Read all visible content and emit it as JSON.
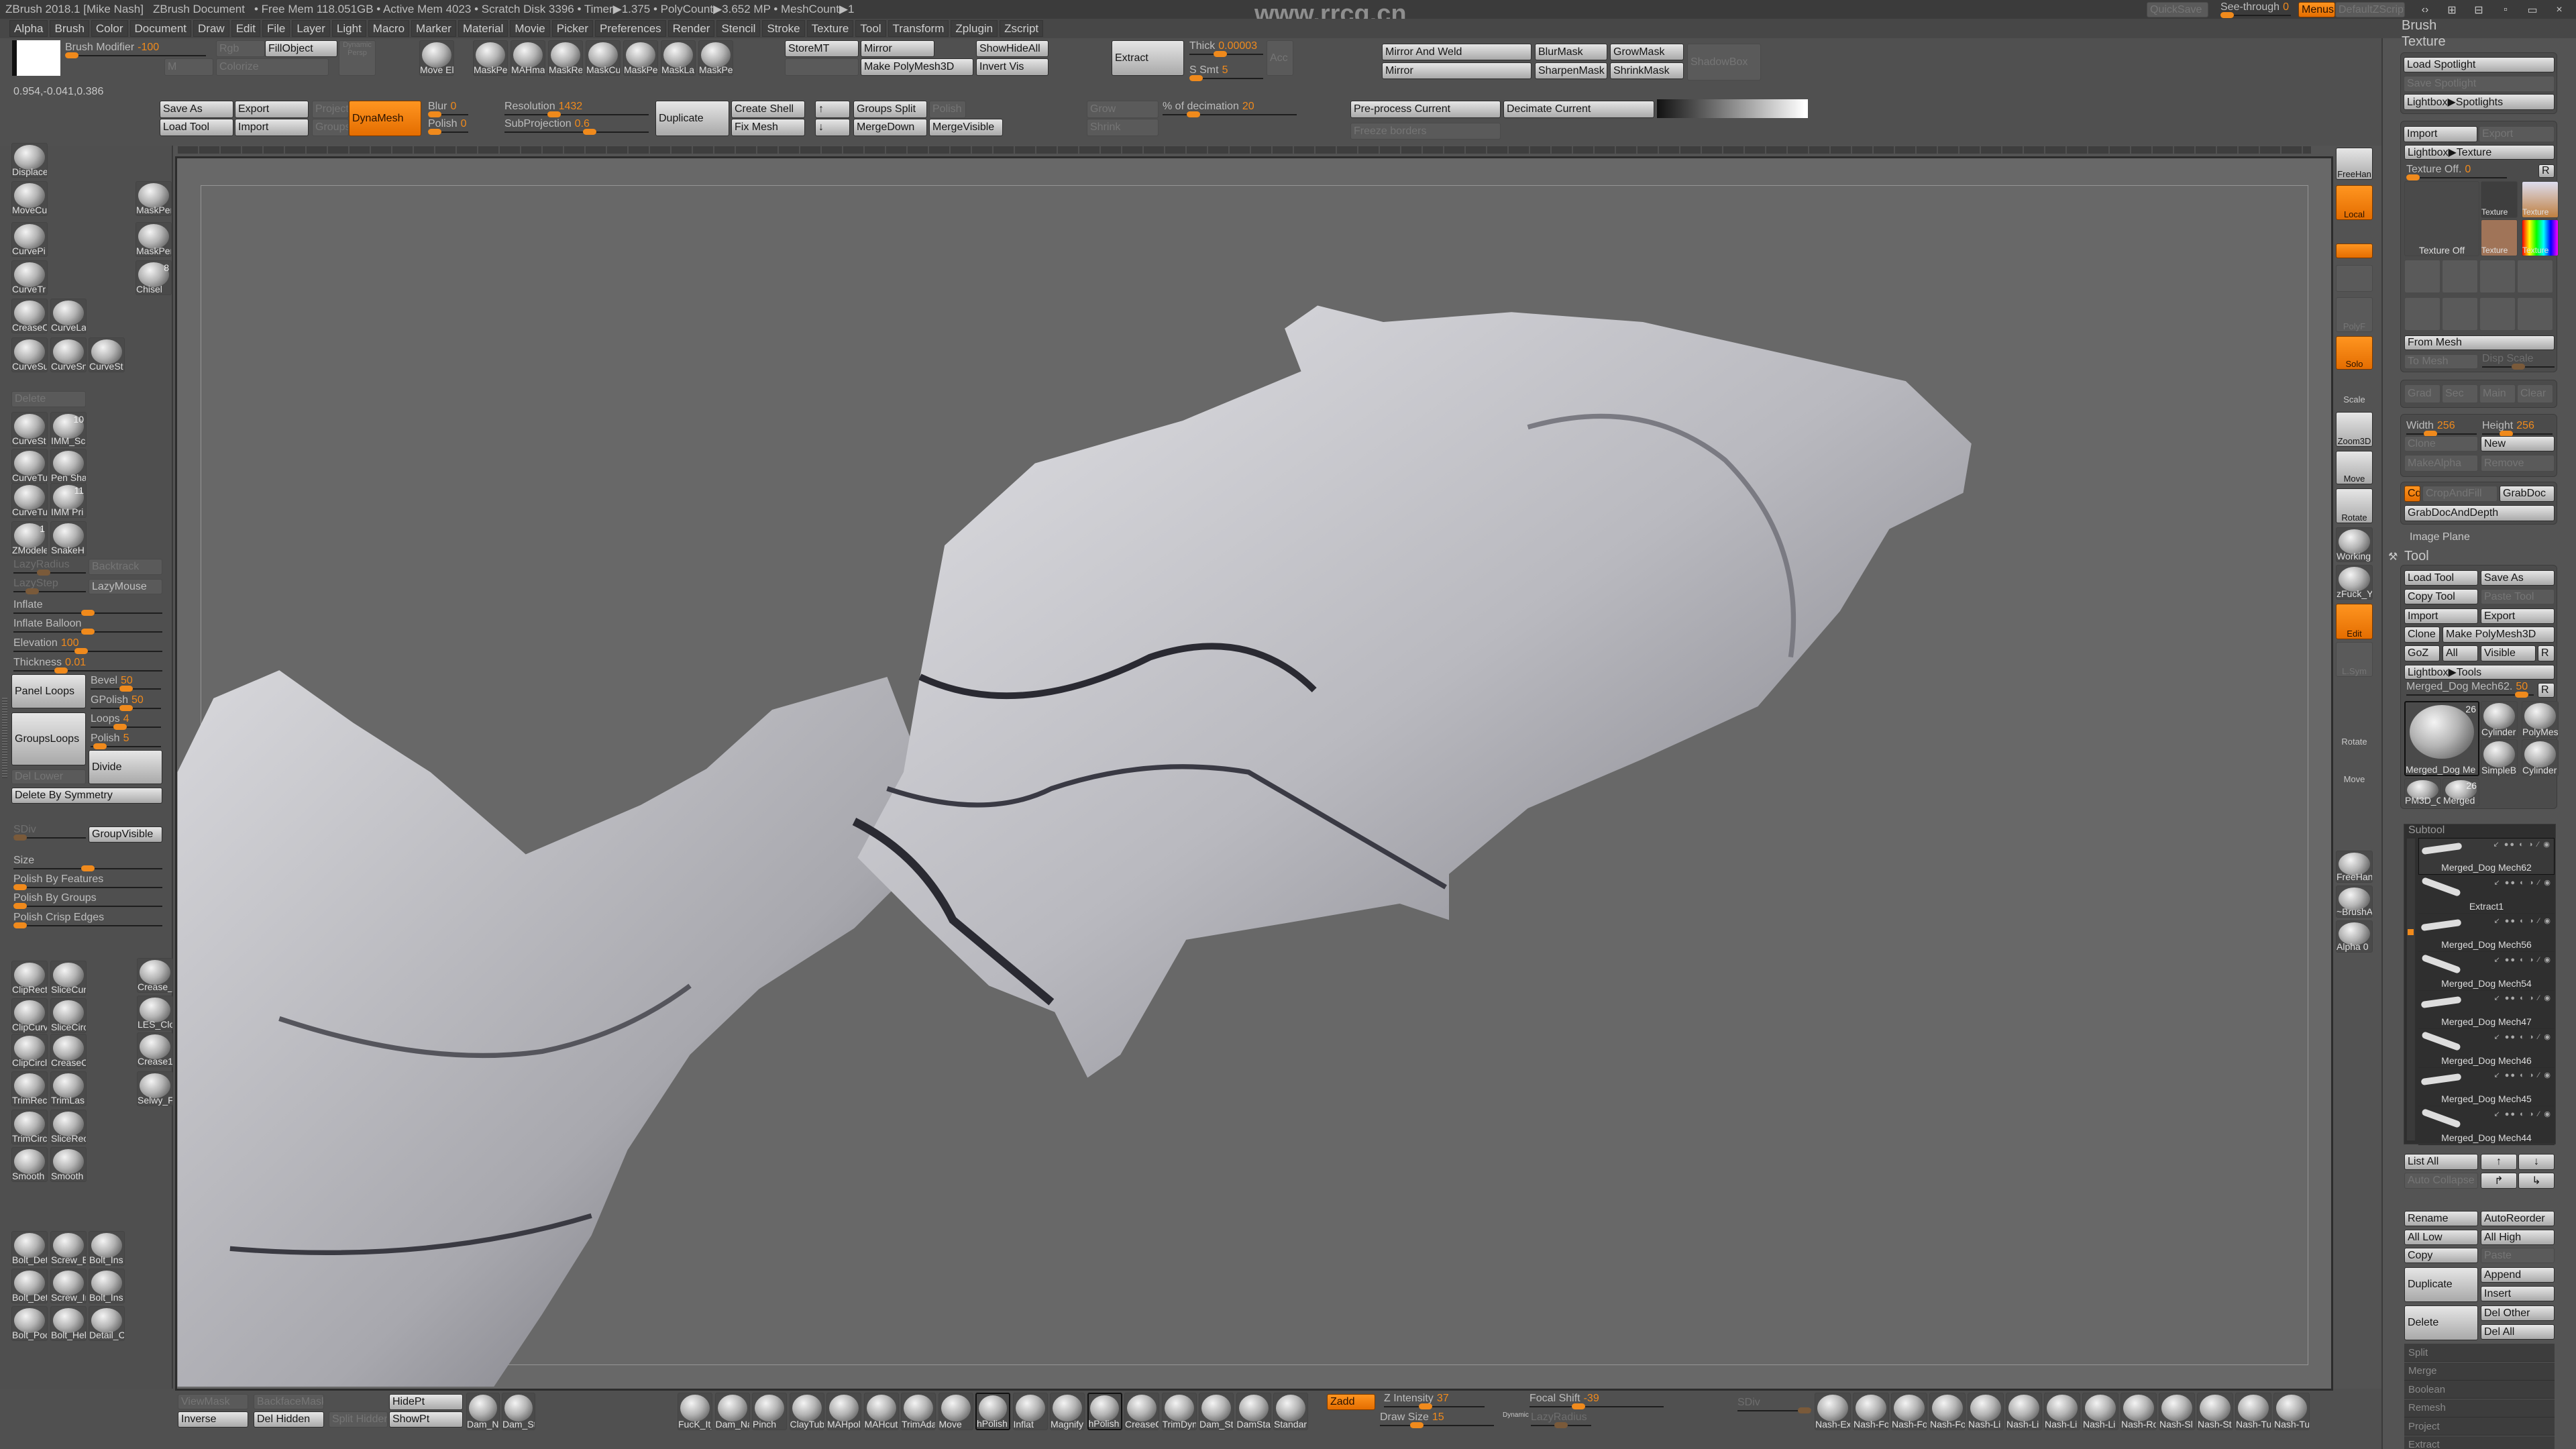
{
  "title_bar": {
    "app": "ZBrush 2018.1 [Mike Nash]",
    "document": "ZBrush Document",
    "stats": "• Free Mem 118.051GB • Active Mem 4023 • Scratch Disk 3396 • Timer▶1.375 • PolyCount▶3.652 MP • MeshCount▶1",
    "watermark": "www.rrcg.cn",
    "quicksave": "QuickSave",
    "see_through_label": "See-through",
    "see_through_value": "0",
    "menus": "Menus",
    "default_zscript": "DefaultZScript"
  },
  "menu": [
    "Alpha",
    "Brush",
    "Color",
    "Document",
    "Draw",
    "Edit",
    "File",
    "Layer",
    "Light",
    "Macro",
    "Marker",
    "Material",
    "Movie",
    "Picker",
    "Preferences",
    "Render",
    "Stencil",
    "Stroke",
    "Texture",
    "Tool",
    "Transform",
    "Zplugin",
    "Zscript"
  ],
  "top_shelf": {
    "brush_modifier_label": "Brush Modifier",
    "brush_modifier_value": "-100",
    "rgb": "Rgb",
    "fill_object": "FillObject",
    "m": "M",
    "colorize": "Colorize",
    "dynamic": "Dynamic",
    "persp": "Persp",
    "coords": "0.954,-0.041,0.386",
    "mask_brushes": [
      "Move El",
      "MaskPe",
      "MAHma",
      "MaskRe",
      "MaskCu",
      "MaskPe",
      "MaskLa",
      "MaskPe"
    ],
    "store_mt": "StoreMT",
    "mirror": "Mirror",
    "show_hide_all": "ShowHideAll",
    "make_polymesh": "Make PolyMesh3D",
    "invert_vis": "Invert Vis",
    "extract": "Extract",
    "thick_label": "Thick",
    "thick_value": "0.00003",
    "ssmt_label": "S Smt",
    "ssmt_value": "5",
    "acc": "Acc",
    "save_as": "Save As",
    "export": "Export",
    "project": "Project",
    "dynamesh": "DynaMesh",
    "load_tool": "Load Tool",
    "import": "Import",
    "groups": "Groups",
    "blur_label": "Blur",
    "blur_value": "0",
    "polish_label": "Polish",
    "polish_value": "0",
    "resolution_label": "Resolution",
    "resolution_value": "1432",
    "subprojection_label": "SubProjection",
    "subprojection_value": "0.6",
    "duplicate": "Duplicate",
    "create_shell": "Create Shell",
    "fix_mesh": "Fix Mesh",
    "up": "↑",
    "down": "↓",
    "groups_split": "Groups Split",
    "merge_down": "MergeDown",
    "polish": "Polish",
    "merge_visible": "MergeVisible",
    "grow": "Grow",
    "shrink": "Shrink",
    "decimation_label": "% of decimation",
    "decimation_value": "20",
    "mirror_and_weld": "Mirror And Weld",
    "blur_mask": "BlurMask",
    "grow_mask": "GrowMask",
    "shadowbox": "ShadowBox",
    "mirror2": "Mirror",
    "sharpen_mask": "SharpenMask",
    "shrink_mask": "ShrinkMask",
    "preprocess_current": "Pre-process Current",
    "decimate_current": "Decimate Current",
    "freeze_borders": "Freeze borders"
  },
  "left_panel": {
    "brushes_top": [
      {
        "label": "Displace"
      },
      {
        "label": "MoveCu"
      },
      {
        "label": "MaskPen"
      },
      {
        "label": "CurvePi"
      },
      {
        "label": "MaskPen"
      },
      {
        "label": "CurveTr"
      },
      {
        "label": "Chisel",
        "badge": "8"
      },
      {
        "label": "CreaseC"
      },
      {
        "label": "CurveLa"
      },
      {
        "label": "CurveSu"
      },
      {
        "label": "CurveSn"
      },
      {
        "label": "CurveSt"
      },
      {
        "label": "CurveSt"
      },
      {
        "label": "IMM_Sci",
        "badge": "10"
      },
      {
        "label": "CurveTu"
      },
      {
        "label": "Pen Sha"
      },
      {
        "label": "CurveTu"
      },
      {
        "label": "IMM Pri",
        "badge": "11"
      },
      {
        "label": "ZModele",
        "badge": "1"
      },
      {
        "label": "SnakeH"
      }
    ],
    "delete": "Delete",
    "lazy_radius": "LazyRadius",
    "backtrack": "Backtrack",
    "lazy_step": "LazyStep",
    "lazy_mouse": "LazyMouse",
    "inflate": "Inflate",
    "inflate_balloon": "Inflate Balloon",
    "elevation_label": "Elevation",
    "elevation_value": "100",
    "thickness_label": "Thickness",
    "thickness_value": "0.01",
    "panel_loops": "Panel Loops",
    "bevel_label": "Bevel",
    "bevel_value": "50",
    "gpolish_label": "GPolish",
    "gpolish_value": "50",
    "loops_label": "Loops",
    "loops_value": "4",
    "polish_label": "Polish",
    "polish_value": "5",
    "groups_loops": "GroupsLoops",
    "divide": "Divide",
    "del_lower": "Del Lower",
    "delete_by_symmetry": "Delete By Symmetry",
    "sdiv": "SDiv",
    "group_visible": "GroupVisible",
    "size": "Size",
    "polish_by_features": "Polish By Features",
    "polish_by_groups": "Polish By Groups",
    "polish_crisp_edges": "Polish Crisp Edges",
    "brushes_bottom": [
      "ClipRect",
      "SliceCur",
      "Crease_",
      "ClipCurv",
      "SliceCirc",
      "LES_Clot",
      "ClipCircl",
      "CreaseC",
      "Crease1",
      "TrimRec",
      "TrimLas",
      "Selwy_F",
      "TrimCirc",
      "SliceRec",
      "Smooth",
      "Smooth",
      "Bolt_Det",
      "Screw_B",
      "Bolt_Ins",
      "Bolt_Det",
      "Screw_In",
      "Bolt_Ins",
      "Bolt_Poc",
      "Bolt_Hel",
      "Detail_C"
    ]
  },
  "right_shelf": [
    "FreeHan",
    "Local",
    "",
    "",
    "",
    "PolyF",
    "Solo",
    "Scale",
    "Zoom3D",
    "Move",
    "Rotate",
    "Working",
    "zFuck_Y",
    "Edit",
    "L.Sym",
    "Rotate",
    "Move",
    "FreeHan",
    "~BrushA",
    "Alpha 0"
  ],
  "right_panel": {
    "brush_header": "Brush",
    "texture_header": "Texture",
    "load_spotlight": "Load Spotlight",
    "save_spotlight": "Save Spotlight",
    "lightbox_spotlights": "Lightbox▶Spotlights",
    "import": "Import",
    "export": "Export",
    "lightbox_texture": "Lightbox▶Texture",
    "texture_off_label": "Texture Off.",
    "texture_off_value": "0",
    "r": "R",
    "texture_off": "Texture Off",
    "texture": "Texture",
    "from_mesh": "From Mesh",
    "to_mesh": "To Mesh",
    "disp_scale": "Disp Scale",
    "grad": "Grad",
    "sec": "Sec",
    "main": "Main",
    "clear": "Clear",
    "width_label": "Width",
    "width_value": "256",
    "height_label": "Height",
    "height_value": "256",
    "clone": "Clone",
    "new": "New",
    "make_alpha": "MakeAlpha",
    "remove": "Remove",
    "cd": "Cd",
    "crop_and_fill": "CropAndFill",
    "grab_doc": "GrabDoc",
    "grab_doc_and_depth": "GrabDocAndDepth",
    "image_plane": "Image Plane",
    "tool_header": "Tool",
    "load_tool": "Load Tool",
    "save_as": "Save As",
    "copy_tool": "Copy Tool",
    "paste_tool": "Paste Tool",
    "tool_import": "Import",
    "tool_export": "Export",
    "tool_clone": "Clone",
    "make_polymesh": "Make PolyMesh3D",
    "goz": "GoZ",
    "all": "All",
    "visible": "Visible",
    "lightbox_tools": "Lightbox▶Tools",
    "current_tool_label": "Merged_Dog Mech62.",
    "current_tool_value": "50",
    "tool_thumbs": [
      {
        "label": "Merged_Dog Me",
        "badge": "26"
      },
      {
        "label": "Cylinder"
      },
      {
        "label": "PolyMes"
      },
      {
        "label": "SimpleB"
      },
      {
        "label": "Cylinder"
      },
      {
        "label": "PM3D_C"
      },
      {
        "label": "Merged",
        "badge": "26"
      }
    ],
    "subtool_header": "Subtool",
    "subtools": [
      "Merged_Dog Mech62",
      "Extract1",
      "Merged_Dog Mech56",
      "Merged_Dog Mech54",
      "Merged_Dog Mech47",
      "Merged_Dog Mech46",
      "Merged_Dog Mech45",
      "Merged_Dog Mech44"
    ],
    "list_all": "List All",
    "auto_collapse": "Auto Collapse",
    "rename": "Rename",
    "auto_reorder": "AutoReorder",
    "all_low": "All Low",
    "all_high": "All High",
    "copy": "Copy",
    "paste": "Paste",
    "duplicate": "Duplicate",
    "append": "Append",
    "insert": "Insert",
    "delete": "Delete",
    "del_other": "Del Other",
    "del_all": "Del All",
    "sections": [
      "Split",
      "Merge",
      "Boolean",
      "Remesh",
      "Project",
      "Extract"
    ]
  },
  "bottom_shelf": {
    "view_mask": "ViewMask",
    "backface_mask": "BackfaceMask",
    "inverse": "Inverse",
    "del_hidden": "Del Hidden",
    "split_hidden": "Split Hidden",
    "hide_pt": "HidePt",
    "show_pt": "ShowPt",
    "dam_brushes": [
      "Dam_Na",
      "Dam_Sta"
    ],
    "brushes": [
      "FucK_It_",
      "Dam_Na",
      "Pinch",
      "ClayTub",
      "MAHpol",
      "MAHcut",
      "TrimAda",
      "Move",
      "hPolish",
      "Inflat",
      "Magnify",
      "hPolish",
      "CreaseC",
      "TrimDyn",
      "Dam_St",
      "DamSta",
      "Standar"
    ],
    "zadd": "Zadd",
    "z_intensity_label": "Z Intensity",
    "z_intensity_value": "37",
    "focal_shift_label": "Focal Shift",
    "focal_shift_value": "-39",
    "draw_size_label": "Draw Size",
    "draw_size_value": "15",
    "dynamic": "Dynamic",
    "lazy_radius": "LazyRadius",
    "sdiv": "SDiv",
    "nash_brushes": [
      "Nash-Ex",
      "Nash-Fo",
      "Nash-Fo",
      "Nash-Fo",
      "Nash-Li",
      "Nash-Li",
      "Nash-Li",
      "Nash-Li",
      "Nash-Ro",
      "Nash-Sl",
      "Nash-St",
      "Nash-Tu",
      "Nash-Tu"
    ]
  },
  "colors": {
    "accent": "#f08a1c",
    "background": "#535353",
    "canvas": "#686868"
  }
}
